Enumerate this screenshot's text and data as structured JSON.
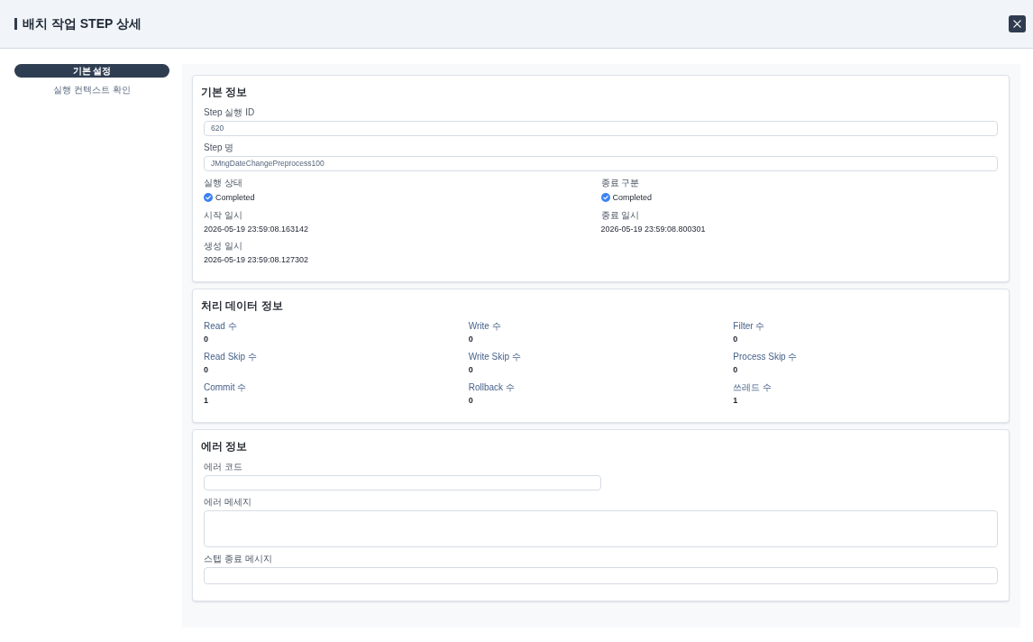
{
  "header": {
    "title": "배치 작업 STEP 상세"
  },
  "sidebar": {
    "items": [
      {
        "label": "기본 설정",
        "selected": true
      },
      {
        "label": "실행 컨텍스트 확인",
        "selected": false
      }
    ]
  },
  "sections": [
    {
      "kind": "details",
      "title": "기본 정보",
      "fields": [
        {
          "kind": "input",
          "label": "Step 실행 ID",
          "value": "620"
        },
        {
          "kind": "input",
          "label": "Step 명",
          "value": "JMngDateChangePreprocess100"
        },
        {
          "kind": "status",
          "label": "실행 상태",
          "value": "Completed"
        },
        {
          "kind": "status",
          "label": "종료 구분",
          "value": "Completed"
        },
        {
          "kind": "text",
          "label": "시작 일시",
          "value": "2026-05-19 23:59:08.163142"
        },
        {
          "kind": "text",
          "label": "종료 일시",
          "value": "2026-05-19 23:59:08.800301"
        },
        {
          "kind": "text",
          "label": "생성 일시",
          "value": "2026-05-19 23:59:08.127302"
        }
      ]
    },
    {
      "kind": "counts",
      "title": "처리 데이터 정보",
      "fields": [
        {
          "kind": "count",
          "label": "Read 수",
          "value": "0"
        },
        {
          "kind": "count",
          "label": "Write 수",
          "value": "0"
        },
        {
          "kind": "count",
          "label": "Filter 수",
          "value": "0"
        },
        {
          "kind": "count",
          "label": "Read Skip 수",
          "value": "0"
        },
        {
          "kind": "count",
          "label": "Write Skip 수",
          "value": "0"
        },
        {
          "kind": "count",
          "label": "Process Skip 수",
          "value": "0"
        },
        {
          "kind": "count",
          "label": "Commit 수",
          "value": "1"
        },
        {
          "kind": "count",
          "label": "Rollback 수",
          "value": "0"
        },
        {
          "kind": "count",
          "label": "쓰레드 수",
          "value": "1"
        }
      ]
    },
    {
      "kind": "details",
      "title": "에러 정보",
      "fields": [
        {
          "kind": "short_input",
          "label": "에러 코드"
        },
        {
          "kind": "textarea",
          "label": "에러 메세지"
        },
        {
          "kind": "input",
          "label": "스텝 종료 메시지"
        }
      ]
    }
  ]
}
